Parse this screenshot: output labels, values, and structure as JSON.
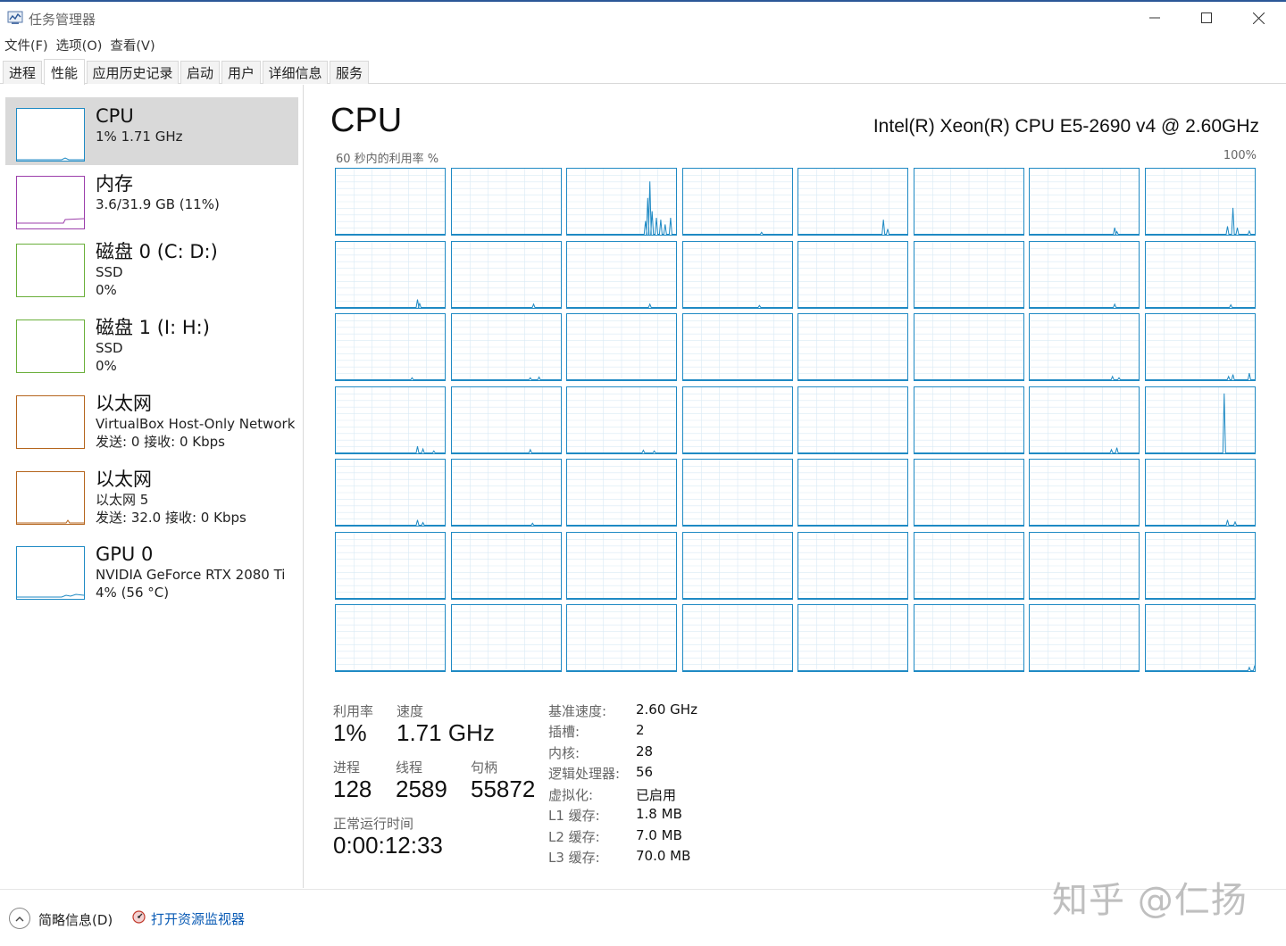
{
  "window": {
    "title": "任务管理器"
  },
  "menu": [
    "文件(F)",
    "选项(O)",
    "查看(V)"
  ],
  "tabs": [
    "进程",
    "性能",
    "应用历史记录",
    "启动",
    "用户",
    "详细信息",
    "服务"
  ],
  "active_tab": "性能",
  "sidebar": {
    "items": [
      {
        "name": "CPU",
        "line1": "1% 1.71 GHz",
        "line2": "",
        "color": "#1f8ac4",
        "active": true
      },
      {
        "name": "内存",
        "line1": "3.6/31.9 GB (11%)",
        "line2": "",
        "color": "#9c3fab"
      },
      {
        "name": "磁盘 0 (C: D:)",
        "line1": "SSD",
        "line2": "0%",
        "color": "#6aaf3a"
      },
      {
        "name": "磁盘 1 (I: H:)",
        "line1": "SSD",
        "line2": "0%",
        "color": "#6aaf3a"
      },
      {
        "name": "以太网",
        "line1": "VirtualBox Host-Only Network",
        "line2": "发送: 0 接收: 0 Kbps",
        "color": "#b5651d"
      },
      {
        "name": "以太网",
        "line1": "以太网 5",
        "line2": "发送: 32.0 接收: 0 Kbps",
        "color": "#b5651d"
      },
      {
        "name": "GPU 0",
        "line1": "NVIDIA GeForce RTX 2080 Ti",
        "line2": "4% (56 °C)",
        "color": "#1f8ac4"
      }
    ]
  },
  "main": {
    "title": "CPU",
    "model": "Intel(R) Xeon(R) CPU E5-2690 v4 @ 2.60GHz",
    "graph_caption": "60 秒内的利用率 %",
    "graph_max": "100%",
    "line_color": "#1f8ac4",
    "grid_color": "#d9eaf5",
    "logical_processor_graphs": 56
  },
  "stats": {
    "utilization": {
      "label": "利用率",
      "value": "1%"
    },
    "speed": {
      "label": "速度",
      "value": "1.71 GHz"
    },
    "processes": {
      "label": "进程",
      "value": "128"
    },
    "threads": {
      "label": "线程",
      "value": "2589"
    },
    "handles": {
      "label": "句柄",
      "value": "55872"
    },
    "uptime": {
      "label": "正常运行时间",
      "value": "0:00:12:33"
    }
  },
  "specs": [
    {
      "label": "基准速度:",
      "value": "2.60 GHz"
    },
    {
      "label": "插槽:",
      "value": "2"
    },
    {
      "label": "内核:",
      "value": "28"
    },
    {
      "label": "逻辑处理器:",
      "value": "56"
    },
    {
      "label": "虚拟化:",
      "value": "已启用"
    },
    {
      "label": "L1 缓存:",
      "value": "1.8 MB"
    },
    {
      "label": "L2 缓存:",
      "value": "7.0 MB"
    },
    {
      "label": "L3 缓存:",
      "value": "70.0 MB"
    }
  ],
  "footer": {
    "fewer_details": "简略信息(D)",
    "open_resource_monitor": "打开资源监视器"
  },
  "watermark": "知乎 @仁扬"
}
